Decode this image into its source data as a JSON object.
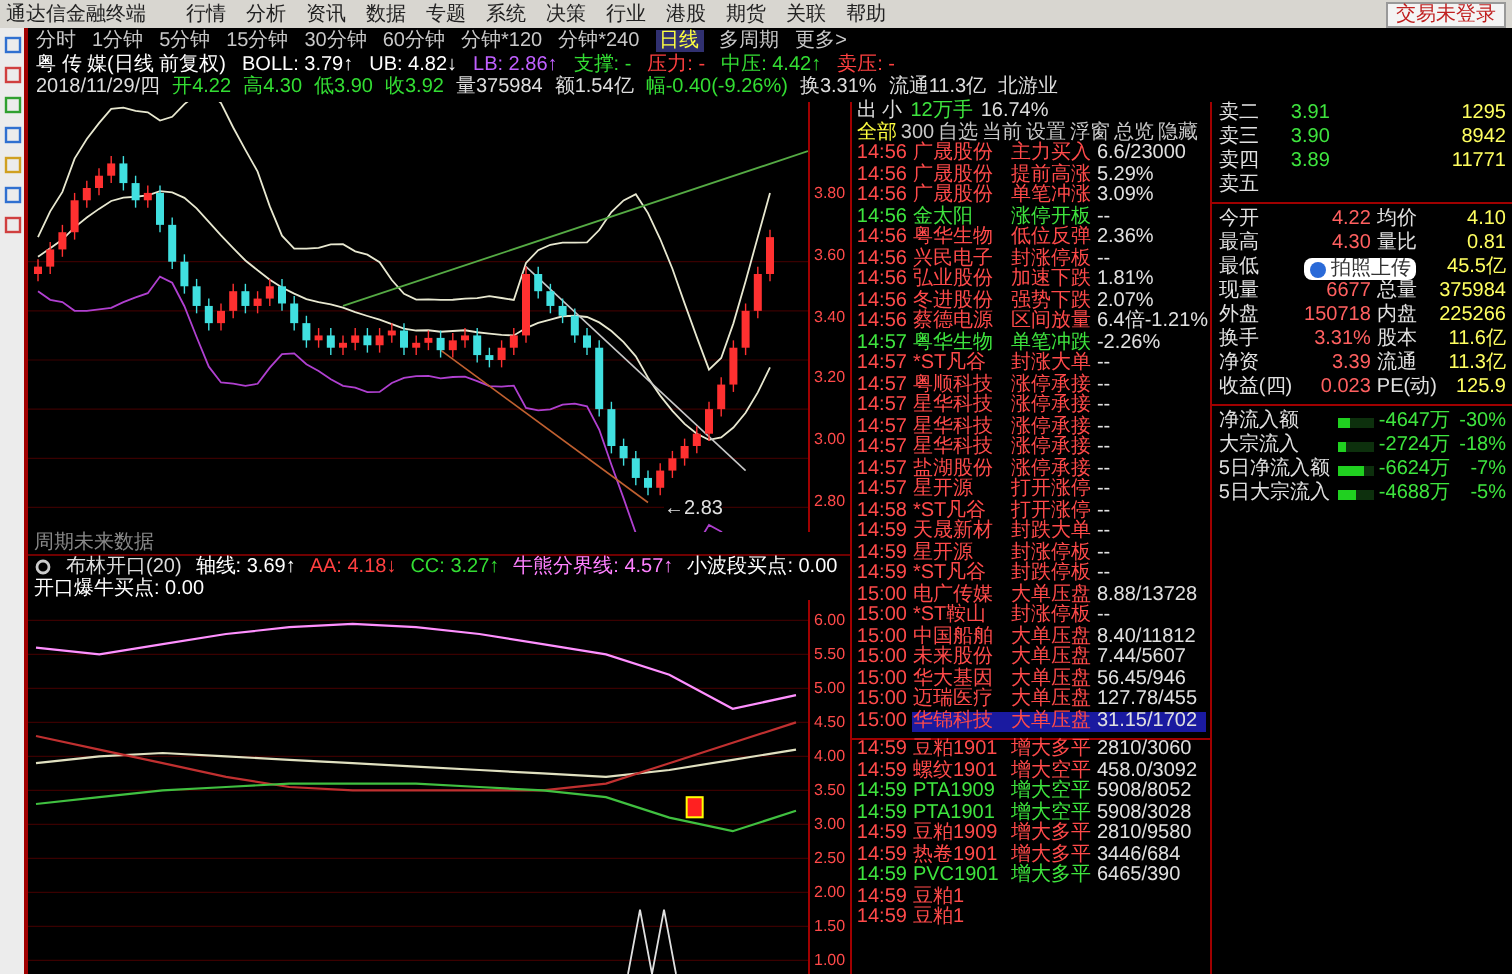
{
  "menu_bar": {
    "app_title": "通达信金融终端",
    "items": [
      "行情",
      "分析",
      "资讯",
      "数据",
      "专题",
      "系统",
      "决策",
      "行业",
      "港股",
      "期货",
      "关联",
      "帮助"
    ],
    "trade_status": "交易未登录"
  },
  "periods": [
    {
      "label": "分时",
      "selected": false
    },
    {
      "label": "1分钟",
      "selected": false
    },
    {
      "label": "5分钟",
      "selected": false
    },
    {
      "label": "15分钟",
      "selected": false
    },
    {
      "label": "30分钟",
      "selected": false
    },
    {
      "label": "60分钟",
      "selected": false
    },
    {
      "label": "分钟*120",
      "selected": false
    },
    {
      "label": "分钟*240",
      "selected": false
    },
    {
      "label": "日线",
      "selected": true
    },
    {
      "label": "多周期",
      "selected": false
    },
    {
      "label": "更多>",
      "selected": false
    }
  ],
  "main_indicator": [
    {
      "text": "粤 传 媒(日线 前复权)",
      "color": "#ffffff"
    },
    {
      "text": "BOLL: 3.79↑",
      "color": "#ffffff"
    },
    {
      "text": "UB: 4.82↓",
      "color": "#ffffff"
    },
    {
      "text": "LB: 2.86↑",
      "color": "#c060ff"
    },
    {
      "text": "支撑: -",
      "color": "#33dd33"
    },
    {
      "text": "压力: -",
      "color": "#ff4040"
    },
    {
      "text": "中压: 4.42↑",
      "color": "#33dd33"
    },
    {
      "text": "卖压: -",
      "color": "#ff4040"
    }
  ],
  "quote_line": [
    {
      "text": "2018/11/29/四",
      "color": "#dddddd"
    },
    {
      "text": "开4.22",
      "color": "#33dd33"
    },
    {
      "text": "高4.30",
      "color": "#33dd33"
    },
    {
      "text": "低3.90",
      "color": "#33dd33"
    },
    {
      "text": "收3.92",
      "color": "#33dd33"
    },
    {
      "text": "量375984",
      "color": "#dddddd"
    },
    {
      "text": "额1.54亿",
      "color": "#dddddd"
    },
    {
      "text": "幅-0.40(-9.26%)",
      "color": "#33dd33"
    },
    {
      "text": "换3.31%",
      "color": "#dddddd"
    },
    {
      "text": "流通11.3亿",
      "color": "#dddddd"
    },
    {
      "text": "北游业",
      "color": "#dddddd"
    }
  ],
  "price_axis": [
    "3.80",
    "3.60",
    "3.40",
    "3.20",
    "3.00",
    "2.80"
  ],
  "low_label": "←2.83",
  "chart_note": "周期未来数据",
  "sub_indicator": [
    {
      "text": "布林开口(20)",
      "color": "#dddddd"
    },
    {
      "text": "轴线: 3.69↑",
      "color": "#ffffff"
    },
    {
      "text": "AA: 4.18↓",
      "color": "#ff4040"
    },
    {
      "text": "CC: 3.27↑",
      "color": "#33dd33"
    },
    {
      "text": "牛熊分界线: 4.57↑",
      "color": "#ff80ff"
    },
    {
      "text": "小波段买点: 0.00",
      "color": "#ffffff"
    },
    {
      "text": "开口爆牛买点: 0.00",
      "color": "#ffffff"
    }
  ],
  "sub_chart": {
    "chart_data": {
      "type": "line",
      "grid": true,
      "ylim": [
        0.8,
        6.3
      ],
      "yticks": [
        {
          "value": 6,
          "label": "6.00"
        },
        {
          "value": 5.5,
          "label": "5.50"
        },
        {
          "value": 5,
          "label": "5.00"
        },
        {
          "value": 4.5,
          "label": "4.50"
        },
        {
          "value": 4,
          "label": "4.00"
        },
        {
          "value": 3.5,
          "label": "3.50"
        },
        {
          "value": 3,
          "label": "3.00"
        },
        {
          "value": 2.5,
          "label": "2.50"
        },
        {
          "value": 2,
          "label": "2.00"
        },
        {
          "value": 1.5,
          "label": "1.50"
        },
        {
          "value": 1,
          "label": "1.00"
        }
      ],
      "series": [
        {
          "color": "#ff90ff",
          "values": [
            5.6,
            5.5,
            5.65,
            5.8,
            5.9,
            5.95,
            5.9,
            5.8,
            5.65,
            5.5,
            5.2,
            4.7,
            4.9
          ]
        },
        {
          "color": "#e0e0c0",
          "values": [
            3.9,
            4.0,
            4.05,
            4.0,
            3.95,
            3.9,
            3.85,
            3.8,
            3.75,
            3.7,
            3.8,
            3.95,
            4.1
          ]
        },
        {
          "color": "#c03030",
          "values": [
            4.3,
            4.1,
            3.9,
            3.7,
            3.55,
            3.5,
            3.5,
            3.5,
            3.5,
            3.6,
            3.9,
            4.2,
            4.5
          ]
        },
        {
          "color": "#40c040",
          "values": [
            3.3,
            3.4,
            3.5,
            3.55,
            3.6,
            3.6,
            3.6,
            3.55,
            3.5,
            3.4,
            3.1,
            2.9,
            3.2
          ]
        }
      ]
    }
  },
  "alerts": {
    "header": {
      "label": "出 小",
      "volume": "12万手",
      "ratio": "16.74%"
    },
    "tabs": [
      {
        "label": "全部",
        "selected": true
      },
      {
        "label": "300",
        "selected": false
      },
      {
        "label": "自选",
        "selected": false
      },
      {
        "label": "当前",
        "selected": false
      },
      {
        "label": "设置",
        "selected": false
      },
      {
        "label": "浮窗",
        "selected": false
      },
      {
        "label": "总览",
        "selected": false
      },
      {
        "label": "隐藏",
        "selected": false
      }
    ],
    "rows": [
      {
        "time": "14:56",
        "name": "广晟股份",
        "event": "主力买入",
        "value": "6.6/23000",
        "color": "#ff4a4a",
        "selected": false
      },
      {
        "time": "14:56",
        "name": "广晟股份",
        "event": "提前高涨",
        "value": "5.29%",
        "color": "#ff4a4a",
        "selected": false
      },
      {
        "time": "14:56",
        "name": "广晟股份",
        "event": "单笔冲涨",
        "value": "3.09%",
        "color": "#ff4a4a",
        "selected": false
      },
      {
        "time": "14:56",
        "name": "金太阳",
        "event": "涨停开板",
        "value": "--",
        "color": "#3ee43e",
        "selected": false
      },
      {
        "time": "14:56",
        "name": "粤华生物",
        "event": "低位反弹",
        "value": "2.36%",
        "color": "#ff4a4a",
        "selected": false
      },
      {
        "time": "14:56",
        "name": "兴民电子",
        "event": "封涨停板",
        "value": "--",
        "color": "#ff4a4a",
        "selected": false
      },
      {
        "time": "14:56",
        "name": "弘业股份",
        "event": "加速下跌",
        "value": "1.81%",
        "color": "#ff4a4a",
        "selected": false
      },
      {
        "time": "14:56",
        "name": "冬进股份",
        "event": "强势下跌",
        "value": "2.07%",
        "color": "#ff4a4a",
        "selected": false
      },
      {
        "time": "14:56",
        "name": "蔡德电源",
        "event": "区间放量",
        "value": "6.4倍-1.21%",
        "color": "#ff4a4a",
        "selected": false
      },
      {
        "time": "14:57",
        "name": "粤华生物",
        "event": "单笔冲跌",
        "value": "-2.26%",
        "color": "#3ee43e",
        "selected": false
      },
      {
        "time": "14:57",
        "name": "*ST凡谷",
        "event": "封涨大单",
        "value": "--",
        "color": "#ff4a4a",
        "selected": false
      },
      {
        "time": "14:57",
        "name": "粤顺科技",
        "event": "涨停承接",
        "value": "--",
        "color": "#ff4a4a",
        "selected": false
      },
      {
        "time": "14:57",
        "name": "星华科技",
        "event": "涨停承接",
        "value": "--",
        "color": "#ff4a4a",
        "selected": false
      },
      {
        "time": "14:57",
        "name": "星华科技",
        "event": "涨停承接",
        "value": "--",
        "color": "#ff4a4a",
        "selected": false
      },
      {
        "time": "14:57",
        "name": "星华科技",
        "event": "涨停承接",
        "value": "--",
        "color": "#ff4a4a",
        "selected": false
      },
      {
        "time": "14:57",
        "name": "盐湖股份",
        "event": "涨停承接",
        "value": "--",
        "color": "#ff4a4a",
        "selected": false
      },
      {
        "time": "14:57",
        "name": "星开源",
        "event": "打开涨停",
        "value": "--",
        "color": "#ff4a4a",
        "selected": false
      },
      {
        "time": "14:58",
        "name": "*ST凡谷",
        "event": "打开涨停",
        "value": "--",
        "color": "#ff4a4a",
        "selected": false
      },
      {
        "time": "14:59",
        "name": "天晟新材",
        "event": "封跌大单",
        "value": "--",
        "color": "#ff4a4a",
        "selected": false
      },
      {
        "time": "14:59",
        "name": "星开源",
        "event": "封涨停板",
        "value": "--",
        "color": "#ff4a4a",
        "selected": false
      },
      {
        "time": "14:59",
        "name": "*ST凡谷",
        "event": "封跌停板",
        "value": "--",
        "color": "#ff4a4a",
        "selected": false
      },
      {
        "time": "15:00",
        "name": "电广传媒",
        "event": "大单压盘",
        "value": "8.88/13728",
        "color": "#ff4a4a",
        "selected": false
      },
      {
        "time": "15:00",
        "name": "*ST鞍山",
        "event": "封涨停板",
        "value": "--",
        "color": "#ff4a4a",
        "selected": false
      },
      {
        "time": "15:00",
        "name": "中国船舶",
        "event": "大单压盘",
        "value": "8.40/11812",
        "color": "#ff4a4a",
        "selected": false
      },
      {
        "time": "15:00",
        "name": "未来股份",
        "event": "大单压盘",
        "value": "7.44/5607",
        "color": "#ff4a4a",
        "selected": false
      },
      {
        "time": "15:00",
        "name": "华大基因",
        "event": "大单压盘",
        "value": "56.45/946",
        "color": "#ff4a4a",
        "selected": false
      },
      {
        "time": "15:00",
        "name": "迈瑞医疗",
        "event": "大单压盘",
        "value": "127.78/455",
        "color": "#ff4a4a",
        "selected": false
      },
      {
        "time": "15:00",
        "name": "华锦科技",
        "event": "大单压盘",
        "value": "31.15/1702",
        "color": "#ff4a4a",
        "selected": true
      }
    ],
    "futures": [
      {
        "time": "14:59",
        "name": "豆粕1901",
        "event": "增大多平",
        "value": "2810/3060",
        "color": "#ff4a4a"
      },
      {
        "time": "14:59",
        "name": "螺纹1901",
        "event": "增大空平",
        "value": "458.0/3092",
        "color": "#ff4a4a"
      },
      {
        "time": "14:59",
        "name": "PTA1909",
        "event": "增大空平",
        "value": "5908/8052",
        "color": "#3ee43e"
      },
      {
        "time": "14:59",
        "name": "PTA1901",
        "event": "增大空平",
        "value": "5908/3028",
        "color": "#3ee43e"
      },
      {
        "time": "14:59",
        "name": "豆粕1909",
        "event": "增大多平",
        "value": "2810/9580",
        "color": "#ff4a4a"
      },
      {
        "time": "14:59",
        "name": "热卷1901",
        "event": "增大多平",
        "value": "3446/684",
        "color": "#ff4a4a"
      },
      {
        "time": "14:59",
        "name": "PVC1901",
        "event": "增大多平",
        "value": "6465/390",
        "color": "#3ee43e"
      },
      {
        "time": "14:59",
        "name": "豆粕1",
        "color": "#ff4a4a"
      },
      {
        "time": "14:59",
        "name": "豆粕1",
        "color": "#ff4a4a"
      }
    ]
  },
  "quote": {
    "asks": [
      {
        "label": "卖二",
        "price": "3.91",
        "volume": "1295"
      },
      {
        "label": "卖三",
        "price": "3.90",
        "volume": "8942"
      },
      {
        "label": "卖四",
        "price": "3.89",
        "volume": "11771"
      },
      {
        "label": "卖五"
      }
    ],
    "stats": [
      {
        "label": "今开",
        "value": "4.22",
        "label2": "均价",
        "value2": "4.10"
      },
      {
        "label": "最高",
        "value": "4.30",
        "label2": "量比",
        "value2": "0.81"
      },
      {
        "label": "最低",
        "value2": "45.5亿"
      },
      {
        "label": "现量",
        "value": "6677",
        "label2": "总量",
        "value2": "375984"
      },
      {
        "label": "外盘",
        "value": "150718",
        "label2": "内盘",
        "value2": "225266"
      },
      {
        "label": "换手",
        "value": "3.31%",
        "label2": "股本",
        "value2": "11.6亿"
      },
      {
        "label": "净资",
        "value": "3.39",
        "label2": "流通",
        "value2": "11.3亿"
      },
      {
        "label": "收益(四)",
        "value": "0.023",
        "label2": "PE(动)",
        "value2": "125.9"
      }
    ],
    "flows": [
      {
        "label": "净流入额",
        "level": 0.3,
        "amount": "-4647万",
        "share": "-30%"
      },
      {
        "label": "大宗流入",
        "level": 0.18,
        "amount": "-2724万",
        "share": "-18%"
      },
      {
        "label": "5日净流入额",
        "level": 0.7,
        "amount": "-6624万",
        "share": "-7%"
      },
      {
        "label": "5日大宗流入",
        "level": 0.5,
        "amount": "-4688万",
        "share": "-5%"
      }
    ]
  },
  "popup": {
    "label": "拍照上传"
  }
}
